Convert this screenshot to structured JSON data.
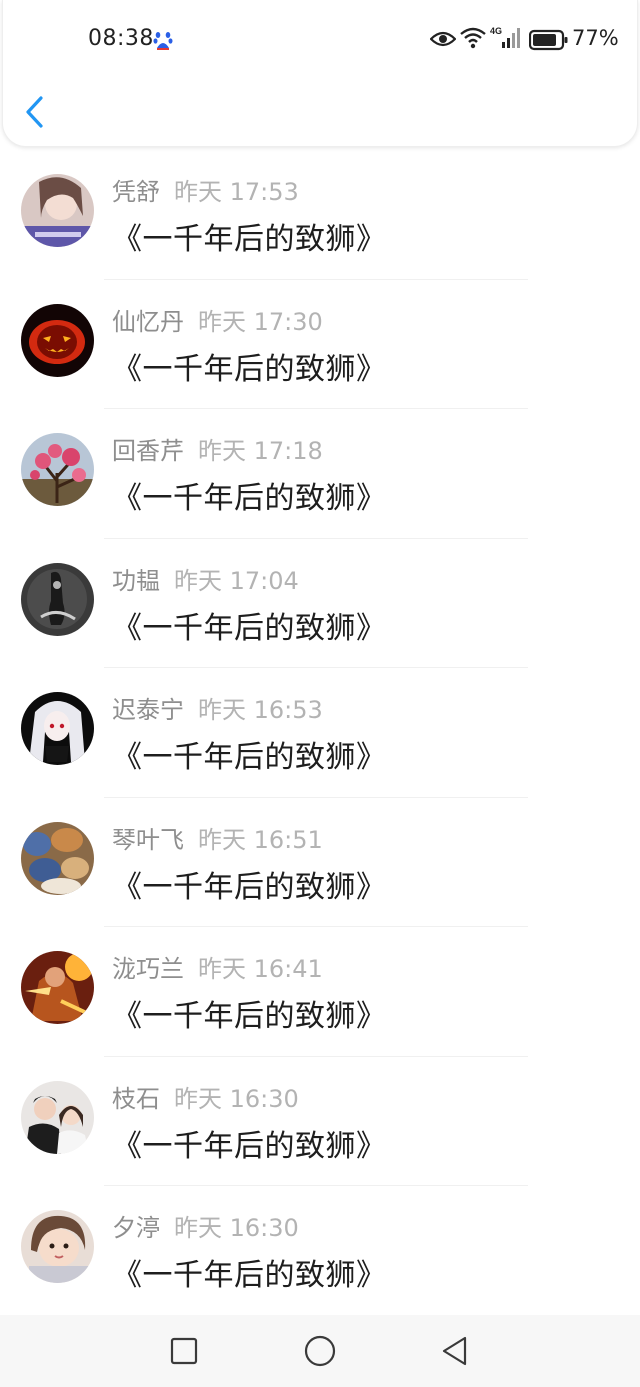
{
  "status_bar": {
    "time": "08:38",
    "battery": "77%",
    "network": "4G"
  },
  "header": {
    "back_icon": "chevron-left-icon",
    "accent_color": "#2196f3"
  },
  "comments": [
    {
      "name": "凭舒",
      "time": "昨天 17:53",
      "text": "《一千年后的致狮》",
      "avatar": "avatar-girl-selfie"
    },
    {
      "name": "仙忆丹",
      "time": "昨天 17:30",
      "text": "《一千年后的致狮》",
      "avatar": "avatar-pumpkin"
    },
    {
      "name": "回香芹",
      "time": "昨天 17:18",
      "text": "《一千年后的致狮》",
      "avatar": "avatar-blossom"
    },
    {
      "name": "功韫",
      "time": "昨天 17:04",
      "text": "《一千年后的致狮》",
      "avatar": "avatar-dark-figure"
    },
    {
      "name": "迟泰宁",
      "time": "昨天 16:53",
      "text": "《一千年后的致狮》",
      "avatar": "avatar-anime-girl"
    },
    {
      "name": "琴叶飞",
      "time": "昨天 16:51",
      "text": "《一千年后的致狮》",
      "avatar": "avatar-seashells"
    },
    {
      "name": "泷巧兰",
      "time": "昨天 16:41",
      "text": "《一千年后的致狮》",
      "avatar": "avatar-warrior"
    },
    {
      "name": "枝石",
      "time": "昨天 16:30",
      "text": "《一千年后的致狮》",
      "avatar": "avatar-couple"
    },
    {
      "name": "夕渟",
      "time": "昨天 16:30",
      "text": "《一千年后的致狮》",
      "avatar": "avatar-child"
    }
  ],
  "nav_bar": {
    "recents_icon": "square-icon",
    "home_icon": "circle-icon",
    "back_icon": "triangle-back-icon"
  }
}
